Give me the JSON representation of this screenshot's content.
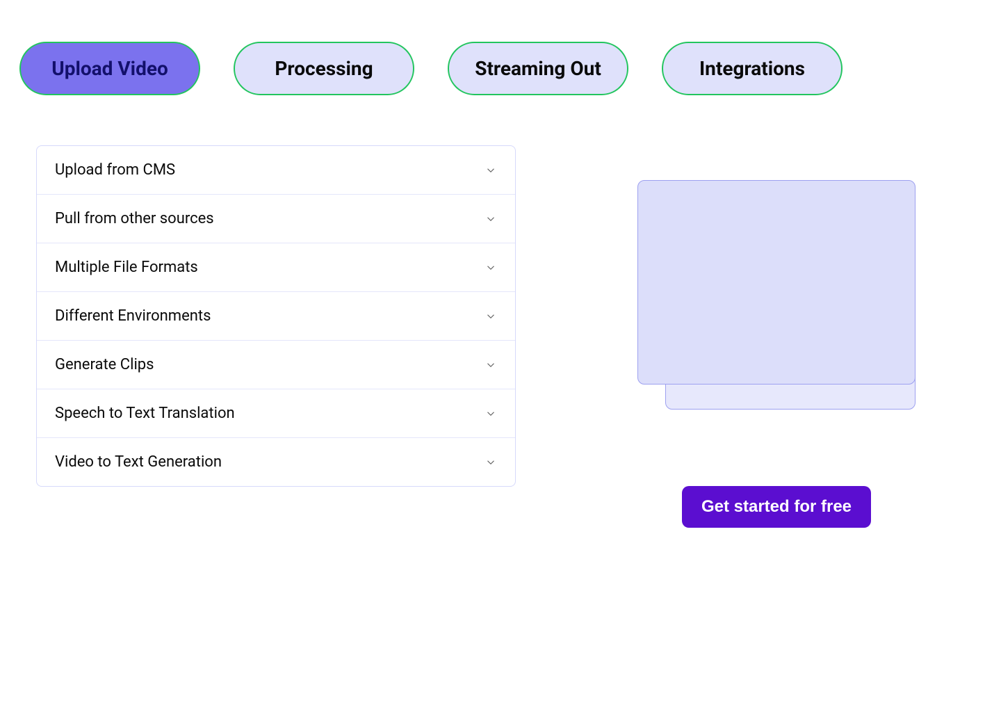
{
  "tabs": [
    {
      "label": "Upload Video",
      "active": true
    },
    {
      "label": "Processing",
      "active": false
    },
    {
      "label": "Streaming Out",
      "active": false
    },
    {
      "label": "Integrations",
      "active": false
    }
  ],
  "accordion_items": [
    {
      "label": "Upload from CMS"
    },
    {
      "label": "Pull from other sources"
    },
    {
      "label": "Multiple File Formats"
    },
    {
      "label": "Different Environments"
    },
    {
      "label": "Generate Clips"
    },
    {
      "label": "Speech to Text Translation"
    },
    {
      "label": "Video to Text Generation"
    }
  ],
  "cta_label": "Get started for free"
}
